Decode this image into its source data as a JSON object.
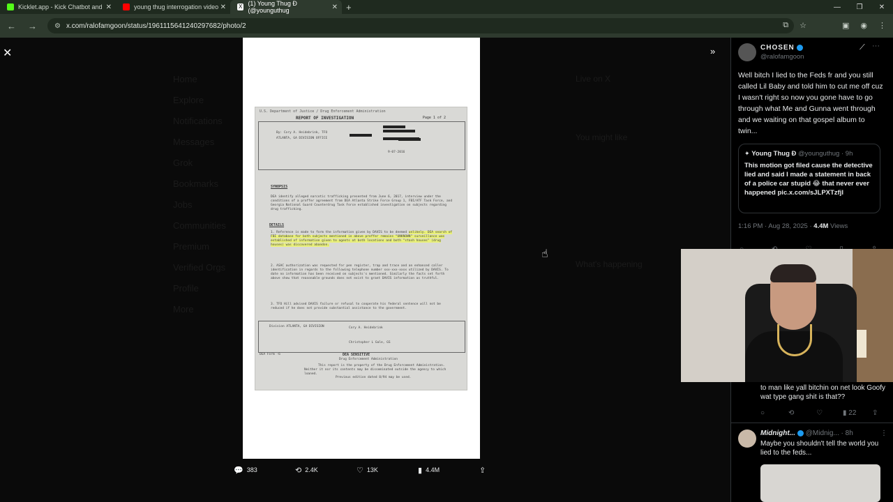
{
  "browser": {
    "tabs": [
      {
        "label": "Kicklet.app - Kick Chatbot and",
        "color": "#53fc18"
      },
      {
        "label": "young thug interrogation video",
        "color": "#ff0000"
      },
      {
        "label": "(1) Young Thug Đ (@younguthug",
        "color": "#ffffff"
      }
    ],
    "url": "x.com/ralofamgoon/status/1961115641240297682/photo/2"
  },
  "post_actions": {
    "replies": "383",
    "reposts": "2.4K",
    "likes": "13K",
    "views": "4.4M"
  },
  "tweet": {
    "name": "CHOSEN",
    "handle": "@ralofamgoon",
    "text": "Well bitch I lied to the Feds fr and you still called Lil Baby and told him to cut me off cuz I wasn't right so now you gone have to go through what Me and Gunna went through and we waiting on that gospel album to twin...",
    "quote": {
      "name": "Young Thug Đ",
      "handle": "@younguthug",
      "time": "9h",
      "text": "This motion got filed cause the detective lied and said I made a statement in back of a police car stupid 😂 that never ever happened pic.x.com/sJLPXTzfjl"
    },
    "timestamp": "1:16 PM · Aug 28, 2025",
    "views_count": "4.4M",
    "views_label": "Views"
  },
  "replies": [
    {
      "text": "to man like yall bitchin on net look Goofy wat type gang shit is that??",
      "views": "22"
    },
    {
      "name": "Midnight...",
      "handle": "@Midnig...",
      "time": "8h",
      "text": "Maybe you shouldn't tell the world you lied to the feds..."
    }
  ],
  "document": {
    "header": "U.S. Department of Justice / Drug Enforcement Administration",
    "title": "REPORT OF INVESTIGATION",
    "page": "Page 1 of 2",
    "by": "By: Cory A. Heidebrink, TFO",
    "office": "ATLANTA, GA DIVISION OFFICE",
    "date": "9-07-2016",
    "synopsis_head": "SYNOPSIS",
    "synopsis": "DEA identify alleged narcotic trafficking presented from June 6, 2017, interview under the conditions of a proffer agreement from DEA Atlanta Strike Force Group 1, FBI/ATF Task Force, and Georgia National Guard Counterdrug Task Force established investigation on subjects regarding drug trafficking.",
    "details_head": "DETAILS",
    "p1a": "1. Reference is made to form the information given by DAVIS to be deemed",
    "p1b": "unlikely. DEA search of FBI database for both subjects mentioned in above proffer remains \"UNKNOWN\" surveillance was established of information given to agents at both locations and both \"stash houses\" (drug houses) was discovered abandon.",
    "p2": "2. ASAC authorization was requested for pen register, trap and trace and an enhanced caller identification in regards to the following telephone number xxx-xxx-xxxx utilized by DAVIS. To date no information has been received on subjects's mentioned. Similarly the facts set forth above show that reasonable grounds does not exist to grant DAVIS information as truthful.",
    "p3": "3. TFO Hill advised DAVIS failure or refusal to cooperate his federal sentence will not be reduced if he does not provide substantial assistance to the government.",
    "dist": "Division ATLANTA, GA DIVISION",
    "signed": "Cory A. Heidebrink",
    "approved": "Christopher L Gale, GS",
    "form": "DEA Form -6",
    "sensitive": "DEA SENSITIVE",
    "sensitive_sub": "Drug Enforcement Administration",
    "footer1": "This report is the property of the Drug Enforcement Administration.",
    "footer2": "Neither it nor its contents may be disseminated outside the agency to which loaned.",
    "footer3": "Previous edition dated 8/94 may be used."
  }
}
